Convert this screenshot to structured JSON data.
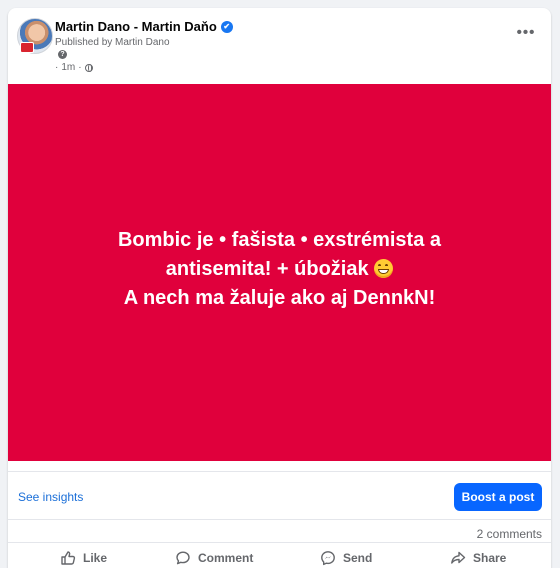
{
  "post": {
    "author": "Martin Dano - Martin Daňo",
    "published_by": "Published by Martin Dano",
    "help_glyph": "?",
    "time": "1m",
    "separator": "·",
    "more_glyph": "•••",
    "image_text": {
      "line1": "Bombic je • fašista • exstrémista a",
      "line2": "antisemita! + úbožiak",
      "line3": "A nech ma žaluje ako aj DennkN!"
    },
    "image_background_color": "#e0003c"
  },
  "insights": {
    "see_insights_label": "See insights",
    "boost_label": "Boost a post"
  },
  "stats": {
    "comments_label": "2 comments"
  },
  "actions": {
    "like_label": "Like",
    "comment_label": "Comment",
    "send_label": "Send",
    "share_label": "Share"
  },
  "icons": {
    "verified": "verified-badge-icon",
    "globe": "globe-icon",
    "emoji": "grinning-face-icon",
    "like": "thumbs-up-icon",
    "comment": "speech-bubble-icon",
    "send": "messenger-icon",
    "share": "share-arrow-icon"
  },
  "colors": {
    "accent": "#0866ff",
    "link": "#1b6fd8",
    "secondary_text": "#65676b"
  }
}
